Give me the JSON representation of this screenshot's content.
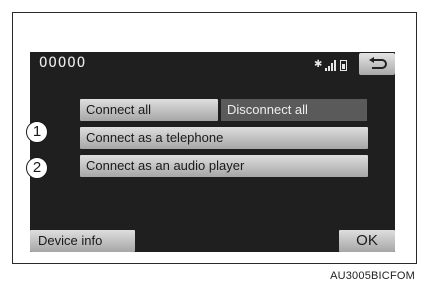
{
  "device": {
    "name": "OOOOO"
  },
  "topbar": {
    "icons": [
      "bluetooth-icon",
      "signal-icon",
      "battery-icon"
    ],
    "back_icon": "back-arrow-icon"
  },
  "buttons": {
    "connect_all": "Connect all",
    "disconnect_all": "Disconnect all",
    "connect_telephone": "Connect as a telephone",
    "connect_audio": "Connect as an audio player",
    "device_info": "Device info",
    "ok": "OK"
  },
  "callouts": [
    "1",
    "2"
  ],
  "figure_code": "AU3005BICFOM"
}
